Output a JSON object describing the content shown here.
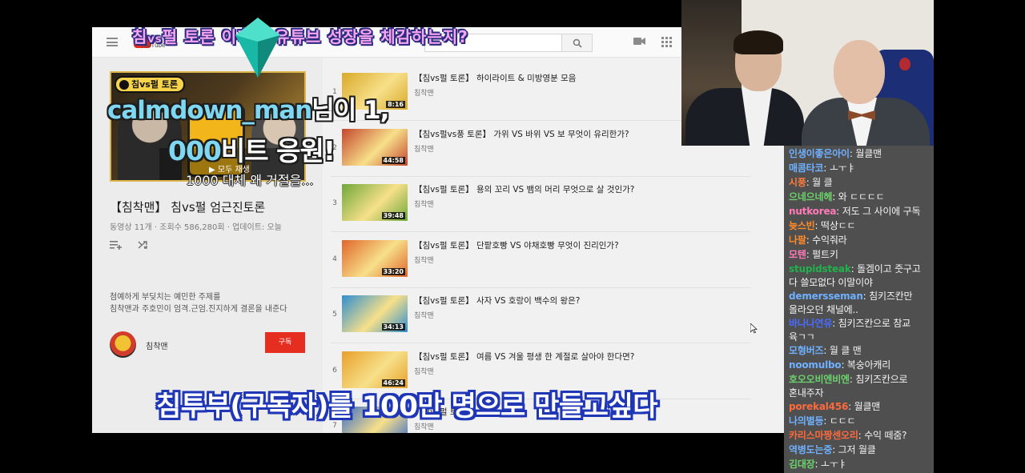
{
  "overlay": {
    "top_text_a": "침",
    "top_text_vs": "vs",
    "top_text_b": "펄 토론 이후의 유튜브 성장을 체감하는지?",
    "donation_user": "calmdown_man",
    "donation_line1_rest": "님이 1,",
    "donation_line2_num": "000",
    "donation_line2_rest": "비트 응원!",
    "donation_message": "1000 대체 왜 거절을...",
    "bottom_caption": "침투부(구독자)를 100만 명으로 만들고싶다"
  },
  "youtube": {
    "logo_text": "YouTube",
    "playlist": {
      "badge": "침vs펄 토론",
      "play_all": "▶ 모두 재생",
      "title": "【침착맨】 침vs펄 엄근진토론",
      "meta": "동영상 11개 · 조회수 586,280회 · 업데이트: 오늘",
      "desc_line1": "첨예하게 부딪치는 예민한 주제를",
      "desc_line2": "침착맨과 주호민이 엄격.근엄.진지하게 결론을 내준다",
      "channel": "침착맨",
      "subscribe": "구독"
    },
    "videos": [
      {
        "index": "1",
        "title": "【침vs펄 토론】 하이라이트 & 미방영분 모음",
        "channel": "침착맨",
        "duration": "8:16",
        "color": "#d9a92a"
      },
      {
        "index": "2",
        "title": "【침vs펄vs풍 토론】 가위 VS 바위 VS 보 무엇이 유리한가?",
        "channel": "침착맨",
        "duration": "44:58",
        "color": "#c4462e"
      },
      {
        "index": "3",
        "title": "【침vs펄 토론】 용의 꼬리 VS 뱀의 머리 무엇으로 살 것인가?",
        "channel": "침착맨",
        "duration": "39:48",
        "color": "#6fa83a"
      },
      {
        "index": "4",
        "title": "【침vs펄 토론】 단팥호빵 VS 야채호빵 무엇이 진리인가?",
        "channel": "침착맨",
        "duration": "33:20",
        "color": "#e0662a"
      },
      {
        "index": "5",
        "title": "【침vs펄 토론】 사자 VS 호랑이 백수의 왕은?",
        "channel": "침착맨",
        "duration": "34:13",
        "color": "#2f8fd0"
      },
      {
        "index": "6",
        "title": "【침vs펄 토론】 여름 VS 겨울 평생 한 계절로 살아야 한다면?",
        "channel": "침착맨",
        "duration": "46:24",
        "color": "#e8a02a"
      },
      {
        "index": "7",
        "title": "【침vs펄 토론】",
        "channel": "침착맨",
        "duration": "",
        "color": "#3a6dc9"
      }
    ]
  },
  "chat": [
    {
      "name": "인생이좋은아이",
      "color": "#6fb0ff",
      "msg": "월클맨"
    },
    {
      "name": "매콤타코",
      "color": "#6fb0ff",
      "msg": "ㅗㅜㅑ"
    },
    {
      "name": "시풍",
      "color": "#ff7a3c",
      "msg": "월 클"
    },
    {
      "name": "으네으네헤",
      "color": "#6cd26c",
      "msg": "와 ㄷㄷㄷㄷ"
    },
    {
      "name": "nutkorea",
      "color": "#ff7ab8",
      "msg": "저도 그 사이에 구독"
    },
    {
      "name": "늦스빈",
      "color": "#ff8a2a",
      "msg": "떡상ㄷㄷ"
    },
    {
      "name": "나팔",
      "color": "#ff8a2a",
      "msg": "수익줘라"
    },
    {
      "name": "모텐",
      "color": "#ff7ab8",
      "msg": "펄트키"
    },
    {
      "name": "stupidsteak",
      "color": "#22b14c",
      "msg": "돌겜이고 줏구고",
      "msg2": "다 쓸모없다 이말이야"
    },
    {
      "name": "demersseman",
      "color": "#6fb0ff",
      "msg": "침키즈칸만",
      "msg2": "올라오던 채널에.."
    },
    {
      "name": "바나나연유",
      "color": "#4b6bff",
      "msg": "침키즈칸으로 참교",
      "msg2": "육ㄱㄱ"
    },
    {
      "name": "모형버즈",
      "color": "#6fb0ff",
      "msg": "월 클 맨"
    },
    {
      "name": "noomulbo",
      "color": "#6fb0ff",
      "msg": "복숭아캐리"
    },
    {
      "name": "호오오비엔비엔",
      "color": "#6cd26c",
      "msg": "침키즈칸으로",
      "msg2": "혼내주자"
    },
    {
      "name": "porekal456",
      "color": "#ff6a3c",
      "msg": "월클맨"
    },
    {
      "name": "나의별등",
      "color": "#6fb0ff",
      "msg": "ㄷㄷㄷ"
    },
    {
      "name": "카리스마짱센오리",
      "color": "#ff6a3c",
      "msg": "수익 떼줌?"
    },
    {
      "name": "역병도는중",
      "color": "#6fb0ff",
      "msg": "그저 월클"
    },
    {
      "name": "김대장",
      "color": "#6cd26c",
      "msg": "ㅗㅜㅑ"
    }
  ]
}
